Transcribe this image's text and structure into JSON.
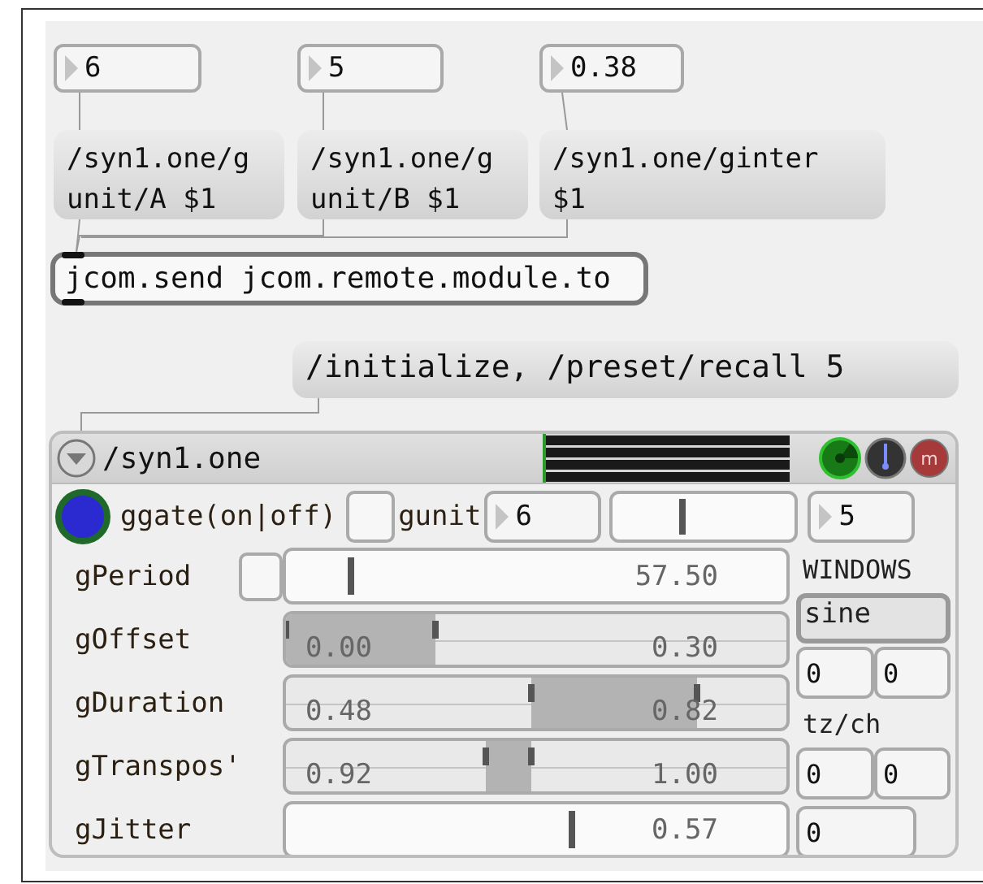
{
  "number_boxes": [
    {
      "value": "6"
    },
    {
      "value": "5"
    },
    {
      "value": "0.38"
    }
  ],
  "messages": [
    {
      "lines": [
        "/syn1.one/g",
        "unit/A $1"
      ]
    },
    {
      "lines": [
        "/syn1.one/g",
        "unit/B $1"
      ]
    },
    {
      "lines": [
        "/syn1.one/ginter",
        "$1"
      ]
    }
  ],
  "object": {
    "text": "jcom.send jcom.remote.module.to"
  },
  "init_message": {
    "text": "/initialize, /preset/recall 5"
  },
  "module": {
    "title": "/syn1.one",
    "module_button": "m",
    "gate": {
      "on": true,
      "label": "ggate(on|off)"
    },
    "gunit_checkbox": {
      "checked": false
    },
    "gunit": {
      "label": "gunit",
      "number_a": "6",
      "slider": {
        "level": 0.38
      },
      "number_b": "5"
    },
    "rows": [
      {
        "kind": "single",
        "label": "gPeriod",
        "checkbox": {
          "checked": false
        },
        "level": 0.13,
        "value": "57.50"
      },
      {
        "kind": "range",
        "label": "gOffset",
        "start": {
          "level": 0,
          "value": "0.00"
        },
        "end": {
          "level": 0.3,
          "value": "0.30"
        }
      },
      {
        "kind": "range",
        "label": "gDuration",
        "start": {
          "level": 0.49,
          "value": "0.48"
        },
        "end": {
          "level": 0.82,
          "value": "0.82"
        }
      },
      {
        "kind": "range",
        "label": "gTranspos'",
        "start": {
          "level": 0.4,
          "value": "0.92"
        },
        "end": {
          "level": 0.49,
          "value": "1.00"
        }
      },
      {
        "kind": "single",
        "label": "gJitter",
        "level": 0.57,
        "value": "0.57"
      }
    ],
    "windows": {
      "label": "WINDOWS",
      "menu": "sine",
      "pair_1": [
        "0",
        "0"
      ],
      "tz_label": "tz/ch",
      "pair_2": [
        "0",
        "0"
      ],
      "single": "0"
    }
  }
}
